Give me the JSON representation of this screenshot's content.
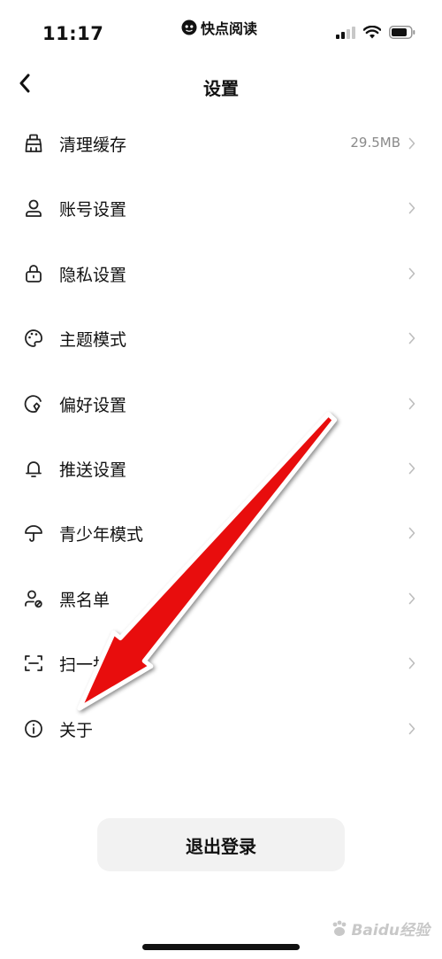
{
  "status_bar": {
    "time": "11:17",
    "app_name": "快点阅读"
  },
  "nav": {
    "title": "设置",
    "back_icon": "chevron-left-icon"
  },
  "settings": {
    "items": [
      {
        "label": "清理缓存",
        "value": "29.5MB",
        "icon": "broom-icon"
      },
      {
        "label": "账号设置",
        "value": "",
        "icon": "person-icon"
      },
      {
        "label": "隐私设置",
        "value": "",
        "icon": "lock-icon"
      },
      {
        "label": "主题模式",
        "value": "",
        "icon": "palette-icon"
      },
      {
        "label": "偏好设置",
        "value": "",
        "icon": "preference-icon"
      },
      {
        "label": "推送设置",
        "value": "",
        "icon": "bell-icon"
      },
      {
        "label": "青少年模式",
        "value": "",
        "icon": "umbrella-icon"
      },
      {
        "label": "黑名单",
        "value": "",
        "icon": "blocked-user-icon"
      },
      {
        "label": "扫一扫",
        "value": "",
        "icon": "scan-icon"
      },
      {
        "label": "关于",
        "value": "",
        "icon": "info-icon"
      }
    ]
  },
  "logout": {
    "label": "退出登录"
  },
  "annotation": {
    "color": "#e8100f"
  },
  "watermark": {
    "text": "Baidu经验"
  },
  "colors": {
    "text_primary": "#111111",
    "text_secondary": "#8a8a8a",
    "button_bg": "#f2f2f2",
    "background": "#ffffff"
  }
}
